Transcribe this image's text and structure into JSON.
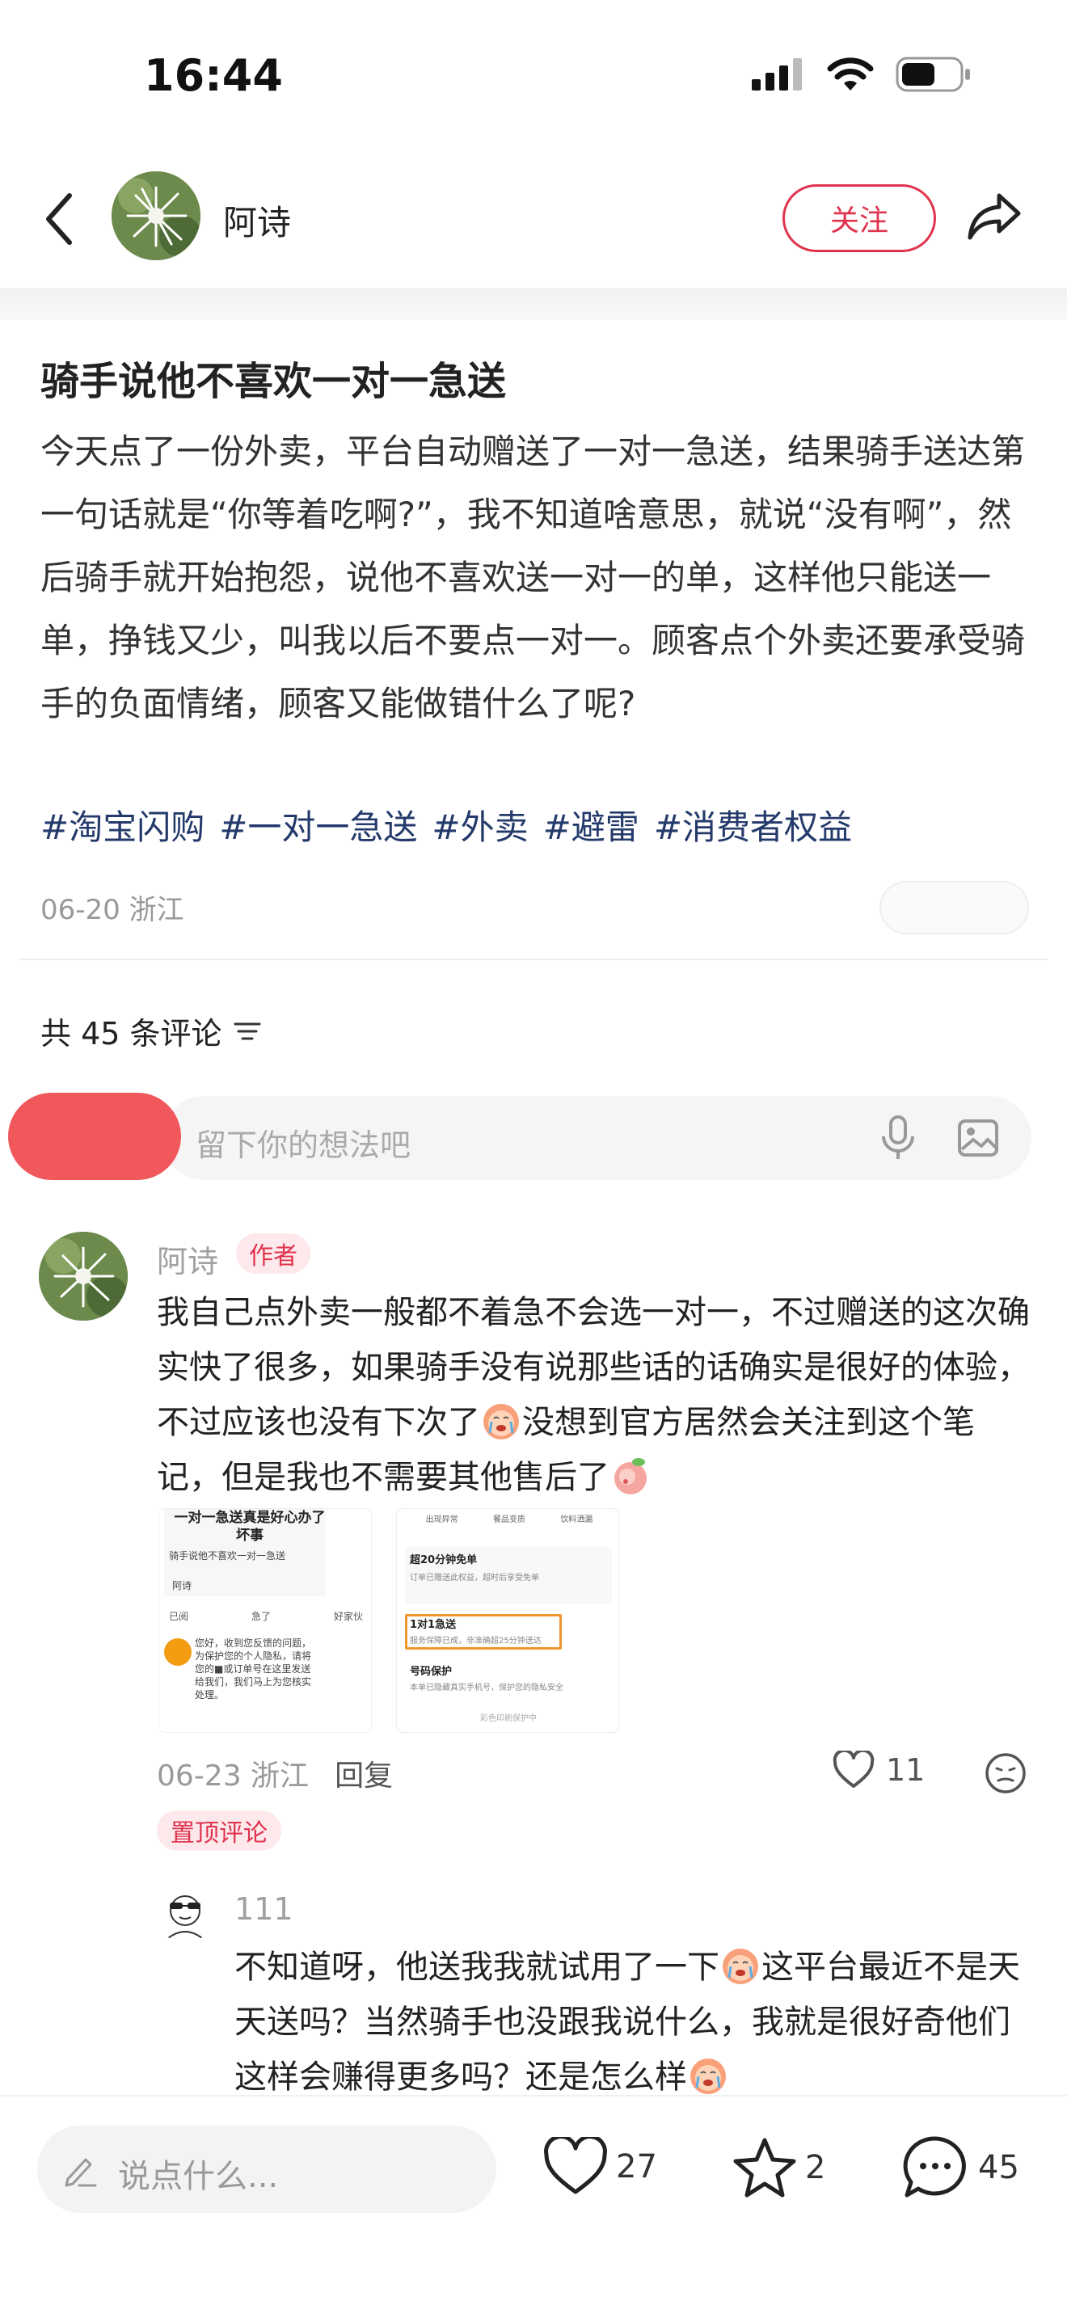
{
  "status_bar": {
    "time": "16:44"
  },
  "header": {
    "author_name": "阿诗",
    "follow_label": "关注"
  },
  "post": {
    "title": "骑手说他不喜欢一对一急送",
    "body": "今天点了一份外卖，平台自动赠送了一对一急送，结果骑手送达第一句话就是“你等着吃啊?”，我不知道啥意思，就说“没有啊”，然后骑手就开始抱怨，说他不喜欢送一对一的单，这样他只能送一单，挣钱又少，叫我以后不要点一对一。顾客点个外卖还要承受骑手的负面情绪，顾客又能做错什么了呢?",
    "tags": [
      "#淘宝闪购",
      "#一对一急送",
      "#外卖",
      "#避雷",
      "#消费者权益"
    ],
    "meta": "06-20 浙江"
  },
  "comments_section": {
    "count_label": "共 45 条评论",
    "input_placeholder": "留下你的想法吧"
  },
  "comment": {
    "name": "阿诗",
    "badge": "作者",
    "text_part1": "我自己点外卖一般都不着急不会选一对一，不过赠送的这次确实快了很多，如果骑手没有说那些话的话确实是很好的体验，不过应该也没有下次了",
    "text_part2": "没想到官方居然会关注到这个笔记，但是我也不需要其他售后了",
    "date_location": "06-23 浙江",
    "reply_label": "回复",
    "likes": "11",
    "pinned_label": "置顶评论",
    "thumb1": {
      "title": "一对一急送真是好心办了坏事",
      "subtitle": "骑手说他不喜欢一对一急送",
      "user": "阿诗",
      "reactions": [
        "已阅",
        "急了",
        "好家伙"
      ],
      "reply": "您好，收到您反馈的问题，为保护您的个人隐私，请将您的■或订单号在这里发送给我们，我们马上为您核实处理。"
    },
    "thumb2": {
      "tabs": [
        "出现异常",
        "餐品变质",
        "饮料洒漏"
      ],
      "row1_title": "超20分钟免单",
      "row1_sub": "订单已赠送此权益，超时后享受免单",
      "row2_title": "1对1急送",
      "row2_sub": "服务保障已成，非准确超25分钟送达",
      "row3_title": "号码保护",
      "row3_sub": "本单已隐藏真实手机号，保护您的隐私安全",
      "footer": "彩色印刷保护中"
    }
  },
  "reply": {
    "name": "111",
    "text_part1": "不知道呀，他送我我就试用了一下",
    "text_part2": "这平台最近不是天天送吗？当然骑手也没跟我说什么，我就是很好奇他们这样会赚得更多吗？还是怎么样"
  },
  "bottom_bar": {
    "input_placeholder": "说点什么...",
    "likes": "27",
    "stars": "2",
    "comments": "45"
  },
  "colors": {
    "accent": "#e0334d",
    "tag": "#243a6b"
  }
}
